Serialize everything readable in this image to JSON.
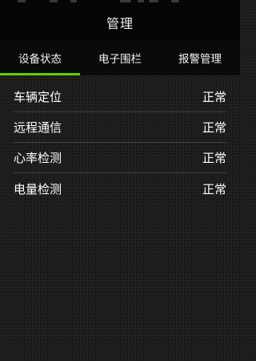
{
  "header": {
    "title": "管理"
  },
  "tabs": [
    {
      "label": "设备状态",
      "active": true
    },
    {
      "label": "电子围栏",
      "active": false
    },
    {
      "label": "报警管理",
      "active": false
    }
  ],
  "status_list": [
    {
      "label": "车辆定位",
      "value": "正常"
    },
    {
      "label": "远程通信",
      "value": "正常"
    },
    {
      "label": "心率检测",
      "value": "正常"
    },
    {
      "label": "电量检测",
      "value": "正常"
    }
  ],
  "colors": {
    "accent": "#5fd000",
    "divider": "#414141",
    "title_bar": "#050505"
  }
}
